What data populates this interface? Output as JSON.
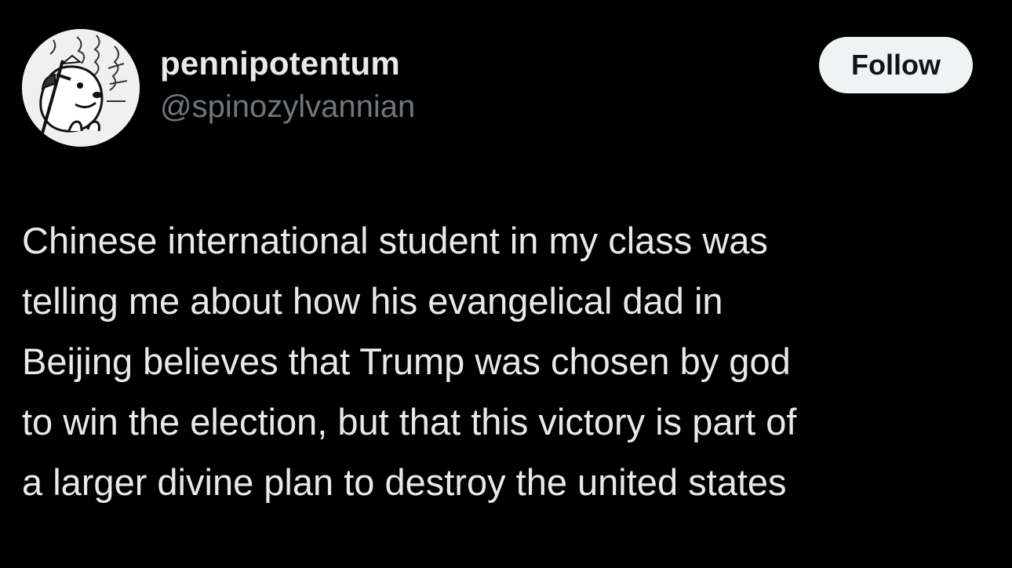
{
  "user": {
    "display_name": "pennipotentum",
    "handle": "@spinozylvannian",
    "avatar_icon": "cartoon-dog-avatar"
  },
  "follow_button": {
    "label": "Follow"
  },
  "tweet": {
    "lines": [
      "Chinese international student in my class was",
      "telling me about how his evangelical dad in",
      "Beijing believes that Trump was chosen by god",
      "to win the election, but that this victory is part of",
      "a larger divine plan to destroy the united states"
    ]
  },
  "colors": {
    "background": "#000000",
    "primary_text": "#e7e9ea",
    "secondary_text": "#71767b",
    "button_bg": "#eff3f4",
    "button_text": "#0f1419"
  }
}
